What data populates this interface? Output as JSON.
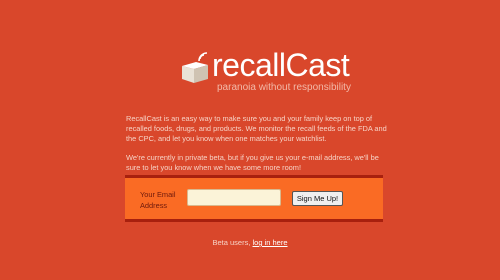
{
  "brand": {
    "title": "recallCast",
    "tagline": "paranoia without responsibility",
    "icon": "broadcasting-box-icon"
  },
  "intro": {
    "paragraph1": "RecallCast is an easy way to make sure you and your family keep on top of recalled foods, drugs, and products. We monitor the recall feeds of the FDA and the CPC, and let you know when one matches your watchlist.",
    "paragraph2": "We're currently in private beta, but if you give us your e-mail address, we'll be sure to let you know when we have some more room!"
  },
  "signup": {
    "label": "Your Email Address",
    "email_value": "",
    "email_placeholder": "",
    "button_label": "Sign Me Up!"
  },
  "footer": {
    "beta_text": "Beta users,",
    "login_link": "log in here"
  },
  "colors": {
    "background": "#d9472b",
    "signup_panel": "#fa6b24",
    "panel_border": "#a8200e",
    "input_background": "#fbf3d8"
  }
}
